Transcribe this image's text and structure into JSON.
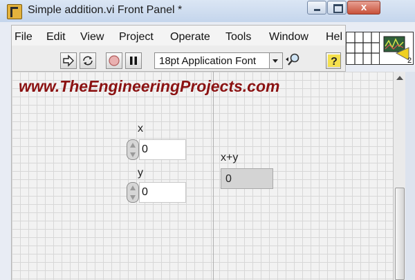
{
  "window": {
    "title": "Simple addition.vi Front Panel *",
    "close_symbol": "x"
  },
  "menu": {
    "items": [
      "File",
      "Edit",
      "View",
      "Project",
      "Operate",
      "Tools",
      "Window",
      "Hel"
    ]
  },
  "toolbar": {
    "font_label": "18pt Application Font",
    "help_symbol": "?",
    "icons": [
      "run-arrow-icon",
      "run-continuously-icon",
      "abort-icon",
      "pause-icon",
      "distribute-icon",
      "search-icon",
      "help-icon"
    ]
  },
  "vi_icon": {
    "number": "2"
  },
  "panel": {
    "watermark": "www.TheEngineeringProjects.com",
    "controls": [
      {
        "label": "x",
        "value": "0"
      },
      {
        "label": "y",
        "value": "0"
      }
    ],
    "indicator": {
      "label": "x+y",
      "value": "0"
    }
  },
  "colors": {
    "watermark": "#8b1212",
    "indicator_bg": "#d4d4d4",
    "grid": "#d7d7d7"
  }
}
